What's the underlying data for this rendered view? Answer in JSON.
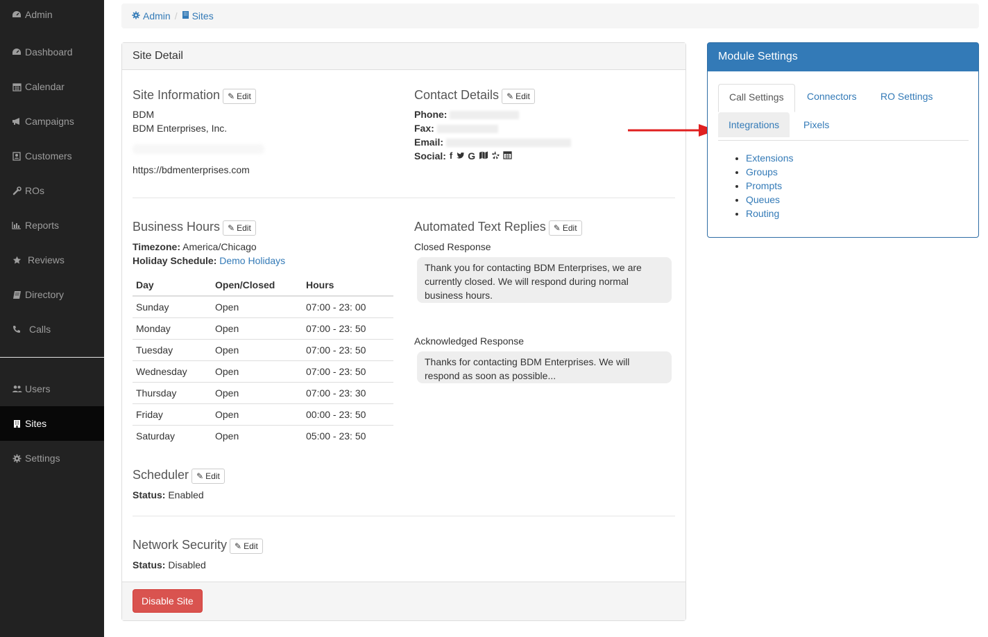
{
  "sidebar": {
    "items_top": [
      {
        "label": "Admin",
        "icon": "dashboard-icon"
      },
      {
        "label": "Dashboard",
        "icon": "dashboard-icon"
      },
      {
        "label": "Calendar",
        "icon": "calendar-icon"
      },
      {
        "label": "Campaigns",
        "icon": "bullhorn-icon"
      },
      {
        "label": "Customers",
        "icon": "contact-card-icon"
      },
      {
        "label": "ROs",
        "icon": "wrench-icon"
      },
      {
        "label": "Reports",
        "icon": "bar-chart-icon"
      },
      {
        "label": "Reviews",
        "icon": "star-icon"
      },
      {
        "label": "Directory",
        "icon": "book-icon"
      },
      {
        "label": "Calls",
        "icon": "phone-icon"
      }
    ],
    "items_bottom": [
      {
        "label": "Users",
        "icon": "users-icon"
      },
      {
        "label": "Sites",
        "icon": "building-icon",
        "active": true
      },
      {
        "label": "Settings",
        "icon": "gear-icon"
      }
    ]
  },
  "breadcrumb": {
    "admin": "Admin",
    "sites": "Sites"
  },
  "site_detail": {
    "heading": "Site Detail",
    "edit_label": "Edit",
    "site_info": {
      "title": "Site Information",
      "name": "BDM",
      "company": "BDM Enterprises, Inc.",
      "url": "https://bdmenterprises.com"
    },
    "contact": {
      "title": "Contact Details",
      "phone_label": "Phone:",
      "fax_label": "Fax:",
      "email_label": "Email:",
      "social_label": "Social:"
    },
    "business_hours": {
      "title": "Business Hours",
      "timezone_label": "Timezone:",
      "timezone": "America/Chicago",
      "holiday_label": "Holiday Schedule:",
      "holiday": "Demo Holidays",
      "columns": [
        "Day",
        "Open/Closed",
        "Hours"
      ],
      "rows": [
        [
          "Sunday",
          "Open",
          "07:00 - 23: 00"
        ],
        [
          "Monday",
          "Open",
          "07:00 - 23: 50"
        ],
        [
          "Tuesday",
          "Open",
          "07:00 - 23: 50"
        ],
        [
          "Wednesday",
          "Open",
          "07:00 - 23: 50"
        ],
        [
          "Thursday",
          "Open",
          "07:00 - 23: 30"
        ],
        [
          "Friday",
          "Open",
          "00:00 - 23: 50"
        ],
        [
          "Saturday",
          "Open",
          "05:00 - 23: 50"
        ]
      ]
    },
    "auto_replies": {
      "title": "Automated Text Replies",
      "closed_label": "Closed Response",
      "closed_text": "Thank you for contacting BDM Enterprises, we are currently closed. We will respond during normal business hours.",
      "ack_label": "Acknowledged Response",
      "ack_text": "Thanks for contacting BDM Enterprises. We will respond as soon as possible..."
    },
    "scheduler": {
      "title": "Scheduler",
      "status_label": "Status:",
      "status": "Enabled"
    },
    "network": {
      "title": "Network Security",
      "status_label": "Status:",
      "status": "Disabled"
    },
    "disable_button": "Disable Site"
  },
  "module_settings": {
    "heading": "Module Settings",
    "tabs": [
      "Call Settings",
      "Connectors",
      "RO Settings",
      "Integrations",
      "Pixels"
    ],
    "links": [
      "Extensions",
      "Groups",
      "Prompts",
      "Queues",
      "Routing"
    ]
  },
  "colors": {
    "sidebar_bg": "#222222",
    "link": "#337ab7",
    "primary": "#337ab7",
    "danger": "#d9534f",
    "arrow": "#e02020"
  }
}
